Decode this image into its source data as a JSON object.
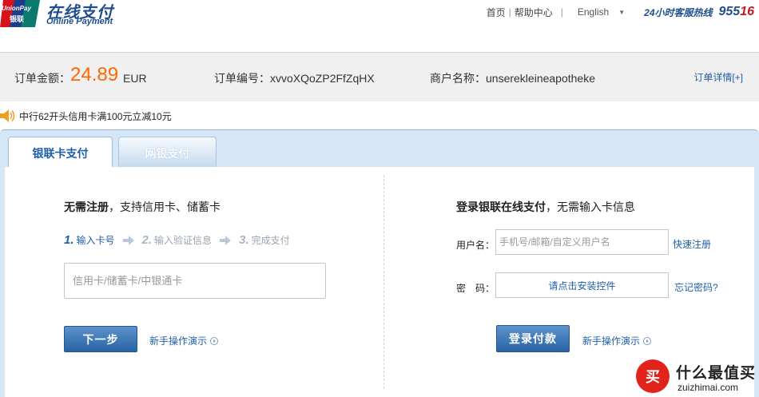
{
  "header": {
    "logo_brand": "UnionPay 银联",
    "logo_cn": "在线支付",
    "logo_en": "Online Payment",
    "nav": {
      "home": "首页",
      "help": "帮助中心",
      "language": "English",
      "hotline_label": "24小时客服热线",
      "hotline_number_a": "955",
      "hotline_number_b": "16"
    }
  },
  "order": {
    "amount_label": "订单金额：",
    "amount_value": "24.89",
    "currency": "EUR",
    "order_no": "订单编号：xvvoXQoZP2FfZqHX",
    "merchant": "商户名称：unserekleineapotheke",
    "detail_link": "订单详情[+]"
  },
  "promo": {
    "text": "中行62开头信用卡满100元立减10元",
    "icon": "speaker-icon"
  },
  "tabs": [
    {
      "label": "银联卡支付",
      "active": true
    },
    {
      "label": "网银支付",
      "active": false
    }
  ],
  "card_pay": {
    "title_bold": "无需注册",
    "title_rest": "，支持信用卡、储蓄卡",
    "steps": [
      {
        "num": "1.",
        "label": "输入卡号",
        "active": true
      },
      {
        "num": "2.",
        "label": "输入验证信息",
        "active": false
      },
      {
        "num": "3.",
        "label": "完成支付",
        "active": false
      }
    ],
    "card_placeholder": "信用卡/储蓄卡/中银通卡",
    "next_button": "下一步",
    "demo_link": "新手操作演示"
  },
  "login_pay": {
    "title_bold": "登录银联在线支付",
    "title_rest": "，无需输入卡信息",
    "username_label": "用户名：",
    "username_placeholder": "手机号/邮箱/自定义用户名",
    "quick_register": "快速注册",
    "password_label": "密　码：",
    "password_install": "请点击安装控件",
    "forgot_password": "忘记密码?",
    "pay_button": "登录付款",
    "demo_link": "新手操作演示"
  },
  "watermark": {
    "badge": "买",
    "cn": "什么最值买",
    "en": "zuizhimai.com"
  },
  "colors": {
    "brand_blue": "#1f4e8c",
    "link_blue": "#1f5fa8",
    "amount_orange": "#ff6600",
    "hotline_red": "#c7161e",
    "panel_blue": "#d5e6f6"
  }
}
